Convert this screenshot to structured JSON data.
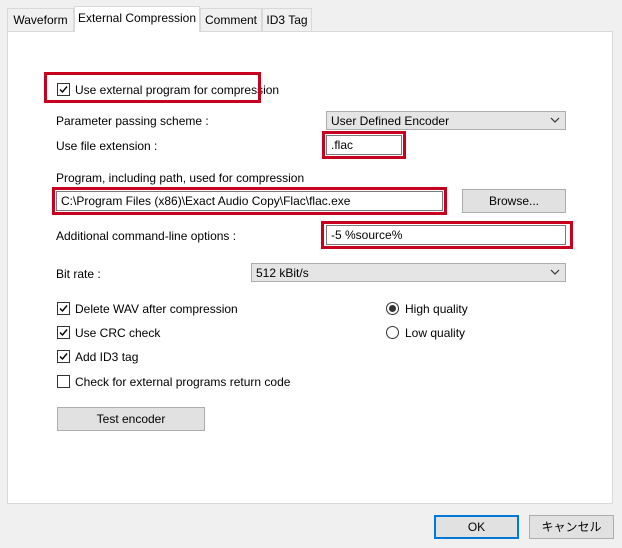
{
  "tabs": [
    "Waveform",
    "External Compression",
    "Comment",
    "ID3 Tag"
  ],
  "use_external": {
    "label": "Use external program for compression",
    "checked": true
  },
  "param_scheme": {
    "label": "Parameter passing scheme :",
    "value": "User Defined Encoder"
  },
  "file_ext": {
    "label": "Use file extension :",
    "value": ".flac"
  },
  "program_path": {
    "label": "Program, including path, used for compression",
    "value": "C:\\Program Files (x86)\\Exact Audio Copy\\Flac\\flac.exe",
    "browse": "Browse..."
  },
  "cmd_options": {
    "label": "Additional command-line options :",
    "value": "-5 %source%"
  },
  "bit_rate": {
    "label": "Bit rate :",
    "value": "512 kBit/s"
  },
  "options": [
    {
      "label": "Delete WAV after compression",
      "checked": true
    },
    {
      "label": "Use CRC check",
      "checked": true
    },
    {
      "label": "Add ID3 tag",
      "checked": true
    },
    {
      "label": "Check for external programs return code",
      "checked": false
    }
  ],
  "quality": [
    {
      "label": "High quality",
      "selected": true
    },
    {
      "label": "Low quality",
      "selected": false
    }
  ],
  "test_encoder": "Test encoder",
  "footer": {
    "ok": "OK",
    "cancel": "キャンセル"
  },
  "colors": {
    "highlight": "#c8001e",
    "default_button_border": "#0078d7"
  }
}
